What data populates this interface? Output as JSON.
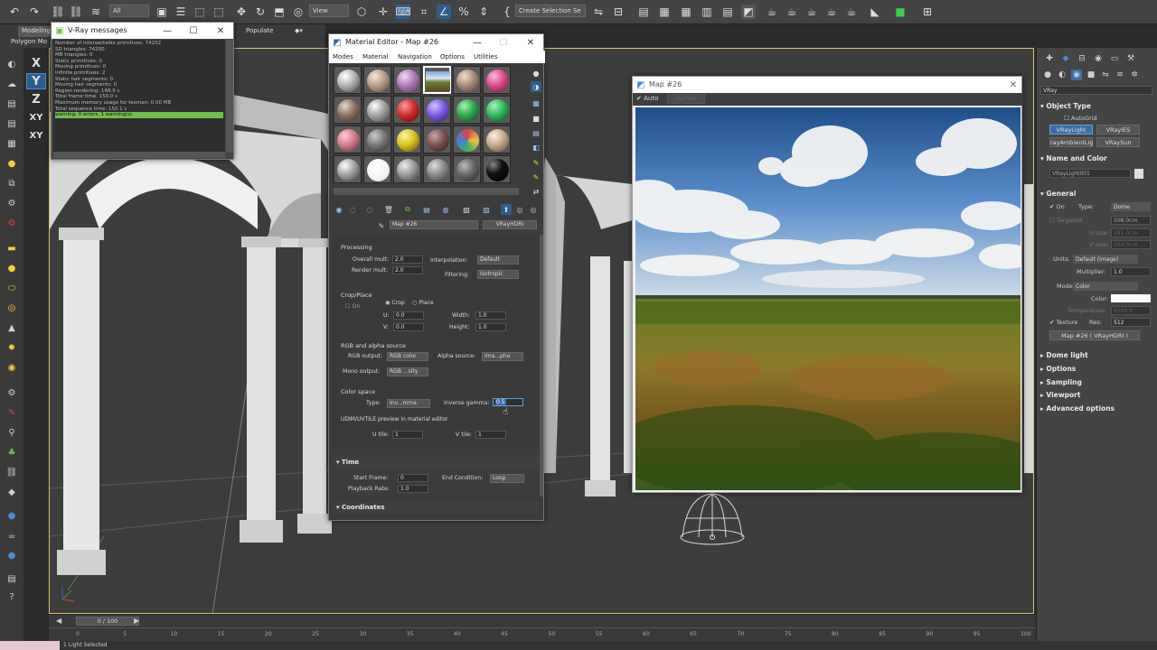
{
  "toolbar": {
    "selection_filter": "All",
    "view_dropdown": "View",
    "create_selection_set": "Create Selection Se"
  },
  "ribbon": {
    "tabs": [
      "Modeling",
      "Populate"
    ],
    "sub_label": "Polygon Mo"
  },
  "axis": [
    "X",
    "Y",
    "Z",
    "XY",
    "XY"
  ],
  "vray_messages": {
    "title": "V-Ray messages",
    "log": [
      "Number of intersectable primitives: 74202",
      "SD triangles: 74200",
      "MB triangles: 0",
      "Static primitives: 0",
      "Moving primitives: 0",
      "Infinite primitives: 2",
      "Static hair segments: 0",
      "Moving hair segments: 0",
      "Region rendering: 148.9 s",
      "Total frame time: 150.0 s",
      "Maximum memory usage for texman: 0.00 MB",
      "Total sequence time: 150.1 s",
      "warning: 0 errors, 1 warning(s)"
    ]
  },
  "material_editor": {
    "title": "Material Editor - Map #26",
    "menu": [
      "Modes",
      "Material",
      "Navigation",
      "Options",
      "Utilities"
    ],
    "map_name": "Map #26",
    "map_type": "VRayHDRI",
    "processing": {
      "title": "Processing",
      "overall_mult_label": "Overall mult:",
      "overall_mult": "2.0",
      "render_mult_label": "Render mult:",
      "render_mult": "2.0",
      "interpolation_label": "Interpolation:",
      "interpolation": "Default",
      "filtering_label": "Filtering:",
      "filtering": "Isotropic"
    },
    "crop_place": {
      "title": "Crop/Place",
      "on_label": "On",
      "crop_label": "Crop",
      "place_label": "Place",
      "u_label": "U:",
      "u": "0.0",
      "v_label": "V:",
      "v": "0.0",
      "width_label": "Width:",
      "width": "1.0",
      "height_label": "Height:",
      "height": "1.0"
    },
    "rgb_alpha": {
      "title": "RGB and alpha source",
      "rgb_output_label": "RGB output:",
      "rgb_output": "RGB color",
      "alpha_source_label": "Alpha source:",
      "alpha_source": "Ima...pha",
      "mono_output_label": "Mono output:",
      "mono_output": "RGB ...sity"
    },
    "color_space": {
      "title": "Color space",
      "type_label": "Type:",
      "type": "Inv...mma",
      "inverse_gamma_label": "Inverse gamma:",
      "inverse_gamma": "0.5"
    },
    "udim": {
      "title": "UDIM/UVTILE preview in material editor",
      "u_tile_label": "U tile:",
      "u_tile": "1",
      "v_tile_label": "V tile:",
      "v_tile": "1"
    },
    "time": {
      "title": "Time",
      "start_frame_label": "Start Frame:",
      "start_frame": "0",
      "end_condition_label": "End Condition:",
      "end_condition": "Loop",
      "playback_rate_label": "Playback Rate:",
      "playback_rate": "1.0"
    },
    "coordinates_title": "Coordinates"
  },
  "map_window": {
    "title": "Map #26",
    "auto_label": "Auto",
    "update_label": "Update"
  },
  "command_panel": {
    "renderer_dropdown": "VRay",
    "object_type_title": "Object Type",
    "autogrid_label": "AutoGrid",
    "buttons": [
      "VRayLight",
      "VRayIES",
      "rayAmbientLig",
      "VRaySun"
    ],
    "name_color_title": "Name and Color",
    "object_name": "VRayLight001",
    "general_title": "General",
    "on_label": "On",
    "type_label": "Type:",
    "type": "Dome",
    "targeted_label": "Targeted",
    "targeted_value": "508.0cm",
    "u_size_label": "U size:",
    "u_size": "391.0cm",
    "v_size_label": "V size:",
    "v_size": "254.0cm",
    "units_label": "Units:",
    "units": "Default (image)",
    "multiplier_label": "Multiplier:",
    "multiplier": "1.0",
    "mode_label": "Mode:",
    "mode": "Color",
    "color_label": "Color:",
    "temperature_label": "Temperature:",
    "temperature": "6500.0",
    "texture_label": "Texture",
    "res_label": "Res:",
    "res": "512",
    "texture_map": "Map #26 ( VRayHDRI )",
    "rollouts": [
      "Dome light",
      "Options",
      "Sampling",
      "Viewport",
      "Advanced options"
    ]
  },
  "timeline": {
    "frame": "0 / 100",
    "ticks": [
      "0",
      "5",
      "10",
      "15",
      "20",
      "25",
      "30",
      "35",
      "40",
      "45",
      "50",
      "55",
      "60",
      "65",
      "70",
      "75",
      "80",
      "85",
      "90",
      "95",
      "100"
    ]
  },
  "status": {
    "selection": "1 Light Selected"
  },
  "colors": {
    "accent_blue": "#3a6ea5",
    "viewport_border": "#d8c06a",
    "log_highlight": "#6fbf4a"
  }
}
